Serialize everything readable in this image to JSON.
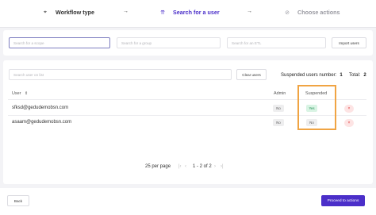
{
  "stepper": {
    "steps": [
      {
        "label": "Workflow type",
        "icon": "target-icon",
        "glyph": "⌖"
      },
      {
        "label": "Search for a user",
        "icon": "user-search-icon",
        "glyph": "⇈"
      },
      {
        "label": "Choose actions",
        "icon": "checklist-icon",
        "glyph": "⊘"
      }
    ],
    "separator": "→"
  },
  "filters": {
    "scope_placeholder": "Search for a scope",
    "group_placeholder": "Search for a group",
    "entity_placeholder": "Search for an ETL",
    "import_label": "Import users"
  },
  "users": {
    "search_placeholder": "Search user on list",
    "clear_label": "Clear users",
    "suspended_label": "Suspended users number:",
    "suspended_count": "1",
    "total_label": "Total:",
    "total_count": "2",
    "columns": {
      "user": "User",
      "sort_glyph": "⇕",
      "admin": "Admin",
      "suspended": "Suspended"
    },
    "rows": [
      {
        "email": "sfksd@gedudemobsn.com",
        "admin": "No",
        "suspended": "Yes",
        "remove": "×"
      },
      {
        "email": "asaam@gedudemobsn.com",
        "admin": "No",
        "suspended": "No",
        "remove": "×"
      }
    ]
  },
  "pagination": {
    "per_page": "25 per page",
    "range": "1 - 2 of 2",
    "first": "|‹",
    "prev": "‹",
    "next": "›",
    "last": "›|"
  },
  "footer": {
    "back_label": "Back",
    "proceed_label": "Proceed to actions"
  },
  "colors": {
    "accent": "#4b2fc9",
    "highlight": "#f0a443"
  }
}
